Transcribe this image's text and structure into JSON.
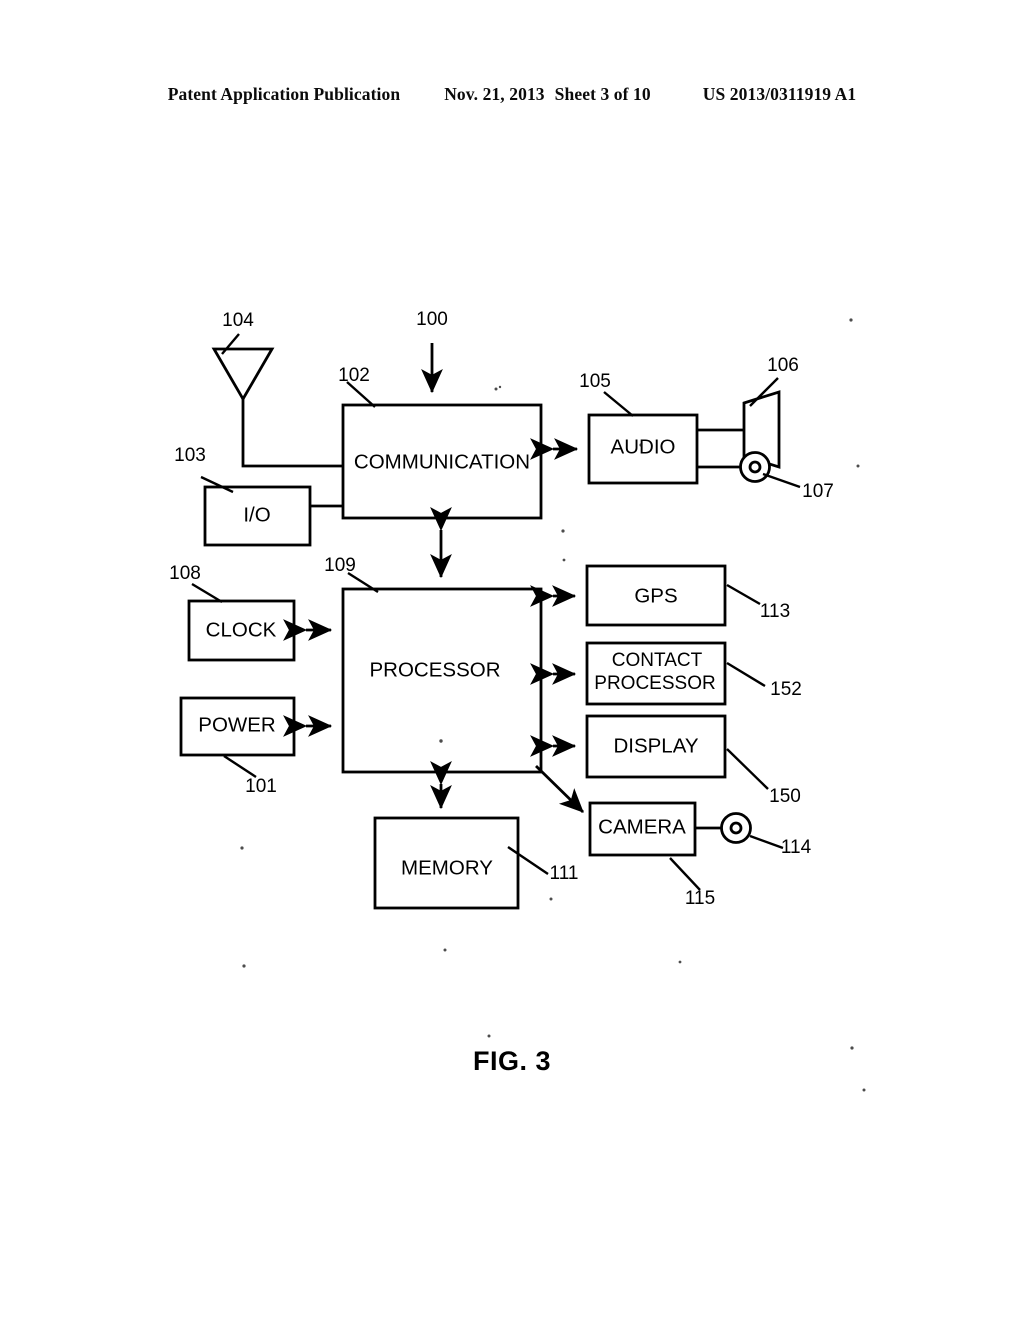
{
  "header": {
    "publication": "Patent Application Publication",
    "date": "Nov. 21, 2013",
    "sheet": "Sheet 3 of 10",
    "doc_number": "US 2013/0311919 A1"
  },
  "figure": {
    "caption": "FIG. 3",
    "blocks": [
      {
        "id": "communication",
        "label": "COMMUNICATION",
        "ref": "102"
      },
      {
        "id": "io",
        "label": "I/O",
        "ref": "103"
      },
      {
        "id": "audio",
        "label": "AUDIO",
        "ref": "105"
      },
      {
        "id": "clock",
        "label": "CLOCK",
        "ref": "108"
      },
      {
        "id": "power",
        "label": "POWER",
        "ref": "101"
      },
      {
        "id": "processor",
        "label": "PROCESSOR",
        "ref": "109"
      },
      {
        "id": "gps",
        "label": "GPS",
        "ref": "113"
      },
      {
        "id": "contact_processor",
        "label_line1": "CONTACT",
        "label_line2": "PROCESSOR",
        "ref": "152"
      },
      {
        "id": "display",
        "label": "DISPLAY",
        "ref": "150"
      },
      {
        "id": "memory",
        "label": "MEMORY",
        "ref": "111"
      },
      {
        "id": "camera",
        "label": "CAMERA",
        "ref": "115"
      }
    ],
    "symbols": [
      {
        "id": "antenna",
        "name": "antenna-symbol",
        "ref": "104"
      },
      {
        "id": "speaker",
        "name": "speaker-symbol",
        "ref": "106"
      },
      {
        "id": "microphone",
        "name": "microphone-symbol",
        "ref": "107"
      },
      {
        "id": "camera_lens",
        "name": "camera-lens-symbol",
        "ref": "114"
      }
    ],
    "system_ref": "100",
    "refs": {
      "system": "100",
      "power": "101",
      "communication": "102",
      "io": "103",
      "antenna": "104",
      "audio": "105",
      "speaker": "106",
      "microphone": "107",
      "clock": "108",
      "processor": "109",
      "memory": "111",
      "gps": "113",
      "camera_lens": "114",
      "camera": "115",
      "display": "150",
      "contact_processor": "152"
    }
  }
}
